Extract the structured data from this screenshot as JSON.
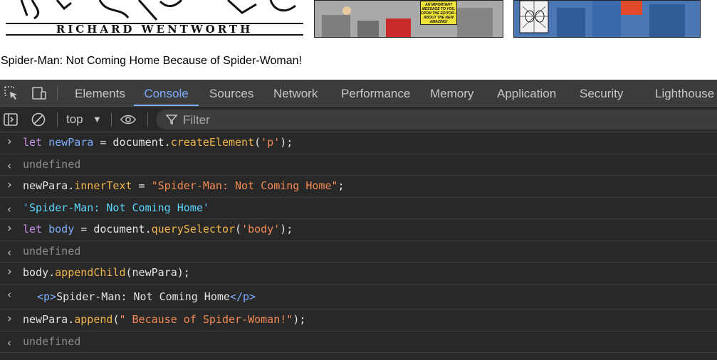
{
  "page": {
    "comic_caption": "RICHARD WENTWORTH",
    "comic_box_text": "AN IMPORTANT MESSAGE TO YOU, FROM THE EDITOR--ABOUT THE NEW AMAZING!",
    "paragraph": "Spider-Man: Not Coming Home Because of Spider-Woman!"
  },
  "devtools": {
    "tabs": [
      "Elements",
      "Console",
      "Sources",
      "Network",
      "Performance",
      "Memory",
      "Application",
      "Security",
      "Lighthouse"
    ],
    "active_tab": "Console",
    "toolbar": {
      "context": "top",
      "filter_placeholder": "Filter"
    },
    "console": {
      "input_glyph": "›",
      "output_glyph": "‹",
      "entries": [
        {
          "type": "input",
          "parts": [
            [
              "kw",
              "let"
            ],
            [
              "plain",
              " "
            ],
            [
              "var",
              "newPara"
            ],
            [
              "plain",
              " = document."
            ],
            [
              "fn",
              "createElement"
            ],
            [
              "plain",
              "("
            ],
            [
              "str",
              "'p'"
            ],
            [
              "plain",
              ");"
            ]
          ]
        },
        {
          "type": "output",
          "parts": [
            [
              "undef",
              "undefined"
            ]
          ]
        },
        {
          "type": "input",
          "parts": [
            [
              "plain",
              "newPara."
            ],
            [
              "fn",
              "innerText"
            ],
            [
              "plain",
              " = "
            ],
            [
              "str",
              "\"Spider-Man: Not Coming Home\""
            ],
            [
              "plain",
              ";"
            ]
          ]
        },
        {
          "type": "output",
          "parts": [
            [
              "strr",
              "'Spider-Man: Not Coming Home'"
            ]
          ]
        },
        {
          "type": "input",
          "parts": [
            [
              "kw",
              "let"
            ],
            [
              "plain",
              " "
            ],
            [
              "var",
              "body"
            ],
            [
              "plain",
              " = document."
            ],
            [
              "fn",
              "querySelector"
            ],
            [
              "plain",
              "("
            ],
            [
              "str",
              "'body'"
            ],
            [
              "plain",
              ");"
            ]
          ]
        },
        {
          "type": "output",
          "parts": [
            [
              "undef",
              "undefined"
            ]
          ]
        },
        {
          "type": "input",
          "parts": [
            [
              "plain",
              "body."
            ],
            [
              "fn",
              "appendChild"
            ],
            [
              "plain",
              "(newPara);"
            ]
          ]
        },
        {
          "type": "output-el",
          "parts": [
            [
              "tag",
              "<p>"
            ],
            [
              "plain",
              "Spider-Man: Not Coming Home"
            ],
            [
              "tag",
              "</p>"
            ]
          ]
        },
        {
          "type": "input",
          "parts": [
            [
              "plain",
              "newPara."
            ],
            [
              "fn",
              "append"
            ],
            [
              "plain",
              "("
            ],
            [
              "str",
              "\" Because of Spider-Woman!\""
            ],
            [
              "plain",
              ");"
            ]
          ]
        },
        {
          "type": "output",
          "parts": [
            [
              "undef",
              "undefined"
            ]
          ]
        }
      ]
    }
  }
}
